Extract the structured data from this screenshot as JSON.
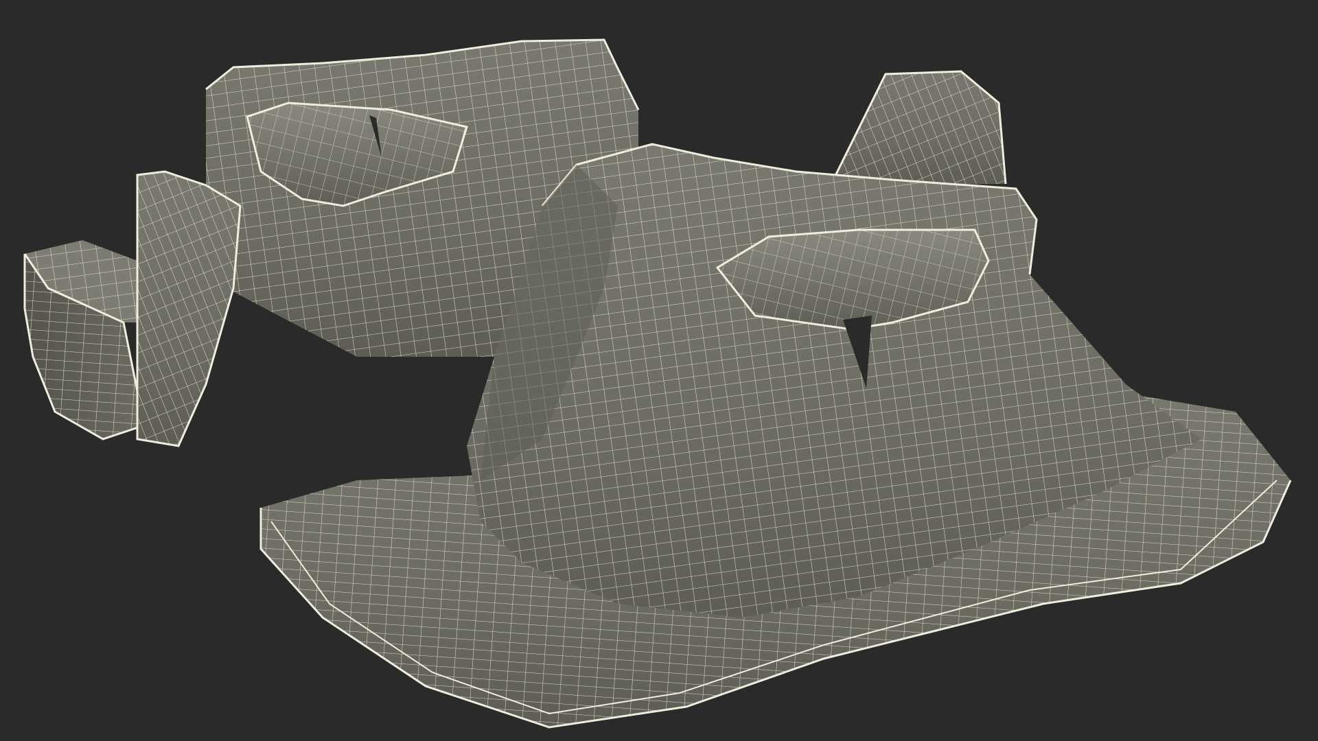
{
  "scene": {
    "background_color": "#2a2a2a",
    "surface_color": "#6f6e64",
    "wire_color": "#e8e6d6",
    "subject": "wireframe-3d-model"
  }
}
